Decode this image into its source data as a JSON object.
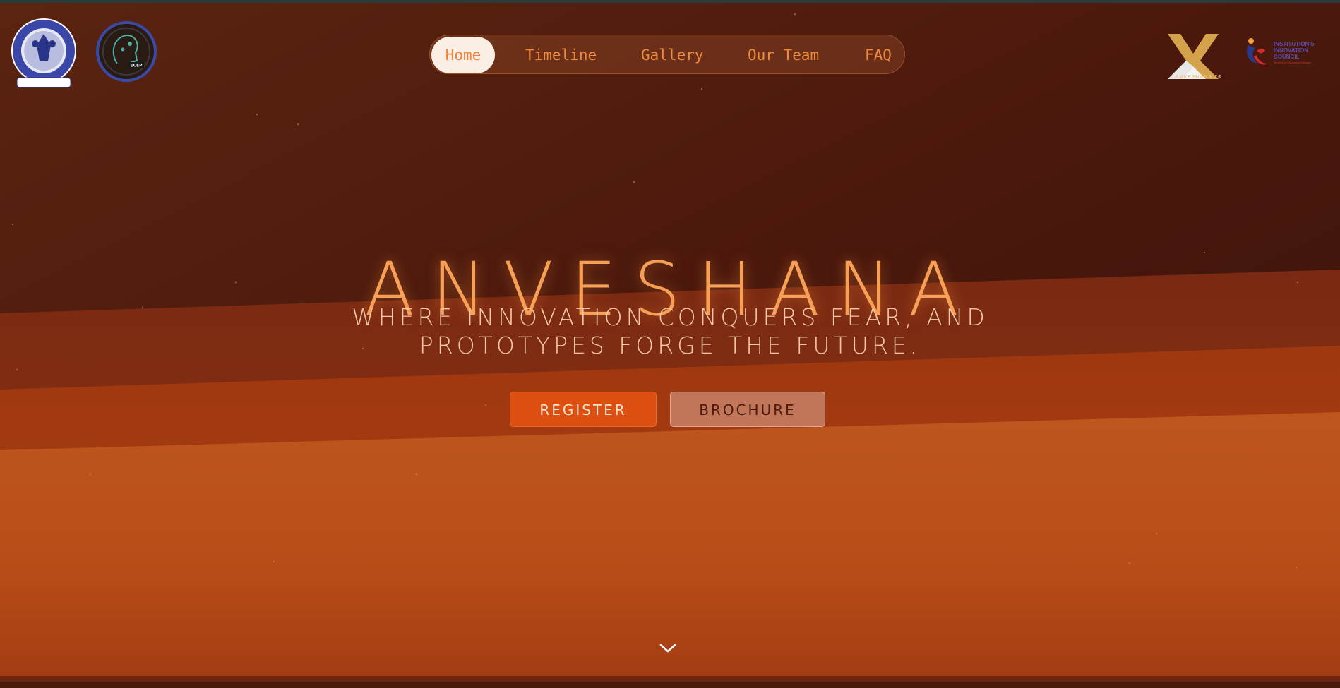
{
  "nav": {
    "items": [
      {
        "label": "Home",
        "active": true
      },
      {
        "label": "Timeline",
        "active": false
      },
      {
        "label": "Gallery",
        "active": false
      },
      {
        "label": "Our Team",
        "active": false
      },
      {
        "label": "FAQ",
        "active": false
      }
    ]
  },
  "hero": {
    "title": "ANVESHANA",
    "subtitle_line1": "Where innovation conquers fear, and",
    "subtitle_line2": "prototypes forge the future.",
    "register_label": "Register",
    "brochure_label": "Brochure"
  },
  "logos": {
    "left": [
      "college-seal-logo",
      "ecep-club-logo"
    ],
    "right": [
      "anveshana-logo",
      "iic-logo"
    ],
    "anveshana_caption": "ANVESHANA 25",
    "iic_text": "INSTITUTION'S INNOVATION COUNCIL",
    "iic_subtext": "Ministry of Education Initiative"
  },
  "icons": {
    "scroll": "chevron-down-icon"
  },
  "colors": {
    "accent": "#f7a055",
    "nav_text": "#f08a3c",
    "register_bg": "#dd4f10",
    "bg_dark": "#3a140a",
    "bg_mid": "#a0380f",
    "bg_light": "#c65a20"
  }
}
